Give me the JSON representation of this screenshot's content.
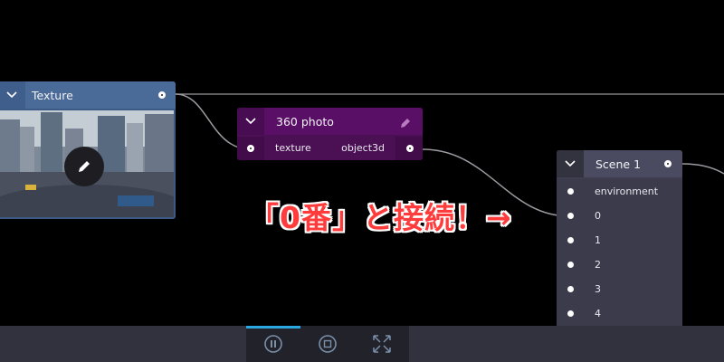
{
  "nodes": {
    "texture": {
      "title": "Texture"
    },
    "photo": {
      "title": "360 photo",
      "input_label": "texture",
      "output_label": "object3d"
    },
    "scene": {
      "title": "Scene 1",
      "inputs": [
        "environment",
        "0",
        "1",
        "2",
        "3",
        "4"
      ]
    }
  },
  "annotation": {
    "text": "「0番」と接続！→"
  },
  "toolbar": {
    "buttons": [
      "pause-button",
      "stop-button",
      "fullscreen-button"
    ]
  },
  "colors": {
    "texture_header": "#4a6b98",
    "photo_header": "#5a0f66",
    "scene_header": "#4a4a60",
    "annotation_text": "#ff3b3b",
    "toolbar_accent": "#2aa7e0"
  }
}
